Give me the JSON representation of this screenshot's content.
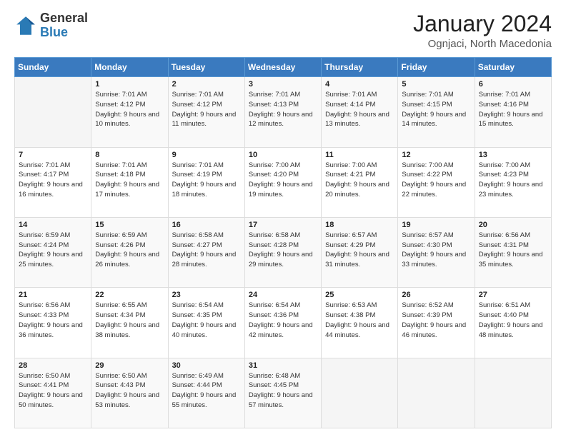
{
  "header": {
    "logo_line1": "General",
    "logo_line2": "Blue",
    "title": "January 2024",
    "subtitle": "Ognjaci, North Macedonia"
  },
  "calendar": {
    "weekdays": [
      "Sunday",
      "Monday",
      "Tuesday",
      "Wednesday",
      "Thursday",
      "Friday",
      "Saturday"
    ],
    "weeks": [
      [
        {
          "day": "",
          "sunrise": "",
          "sunset": "",
          "daylight": "",
          "empty": true
        },
        {
          "day": "1",
          "sunrise": "Sunrise: 7:01 AM",
          "sunset": "Sunset: 4:12 PM",
          "daylight": "Daylight: 9 hours and 10 minutes."
        },
        {
          "day": "2",
          "sunrise": "Sunrise: 7:01 AM",
          "sunset": "Sunset: 4:12 PM",
          "daylight": "Daylight: 9 hours and 11 minutes."
        },
        {
          "day": "3",
          "sunrise": "Sunrise: 7:01 AM",
          "sunset": "Sunset: 4:13 PM",
          "daylight": "Daylight: 9 hours and 12 minutes."
        },
        {
          "day": "4",
          "sunrise": "Sunrise: 7:01 AM",
          "sunset": "Sunset: 4:14 PM",
          "daylight": "Daylight: 9 hours and 13 minutes."
        },
        {
          "day": "5",
          "sunrise": "Sunrise: 7:01 AM",
          "sunset": "Sunset: 4:15 PM",
          "daylight": "Daylight: 9 hours and 14 minutes."
        },
        {
          "day": "6",
          "sunrise": "Sunrise: 7:01 AM",
          "sunset": "Sunset: 4:16 PM",
          "daylight": "Daylight: 9 hours and 15 minutes."
        }
      ],
      [
        {
          "day": "7",
          "sunrise": "Sunrise: 7:01 AM",
          "sunset": "Sunset: 4:17 PM",
          "daylight": "Daylight: 9 hours and 16 minutes."
        },
        {
          "day": "8",
          "sunrise": "Sunrise: 7:01 AM",
          "sunset": "Sunset: 4:18 PM",
          "daylight": "Daylight: 9 hours and 17 minutes."
        },
        {
          "day": "9",
          "sunrise": "Sunrise: 7:01 AM",
          "sunset": "Sunset: 4:19 PM",
          "daylight": "Daylight: 9 hours and 18 minutes."
        },
        {
          "day": "10",
          "sunrise": "Sunrise: 7:00 AM",
          "sunset": "Sunset: 4:20 PM",
          "daylight": "Daylight: 9 hours and 19 minutes."
        },
        {
          "day": "11",
          "sunrise": "Sunrise: 7:00 AM",
          "sunset": "Sunset: 4:21 PM",
          "daylight": "Daylight: 9 hours and 20 minutes."
        },
        {
          "day": "12",
          "sunrise": "Sunrise: 7:00 AM",
          "sunset": "Sunset: 4:22 PM",
          "daylight": "Daylight: 9 hours and 22 minutes."
        },
        {
          "day": "13",
          "sunrise": "Sunrise: 7:00 AM",
          "sunset": "Sunset: 4:23 PM",
          "daylight": "Daylight: 9 hours and 23 minutes."
        }
      ],
      [
        {
          "day": "14",
          "sunrise": "Sunrise: 6:59 AM",
          "sunset": "Sunset: 4:24 PM",
          "daylight": "Daylight: 9 hours and 25 minutes."
        },
        {
          "day": "15",
          "sunrise": "Sunrise: 6:59 AM",
          "sunset": "Sunset: 4:26 PM",
          "daylight": "Daylight: 9 hours and 26 minutes."
        },
        {
          "day": "16",
          "sunrise": "Sunrise: 6:58 AM",
          "sunset": "Sunset: 4:27 PM",
          "daylight": "Daylight: 9 hours and 28 minutes."
        },
        {
          "day": "17",
          "sunrise": "Sunrise: 6:58 AM",
          "sunset": "Sunset: 4:28 PM",
          "daylight": "Daylight: 9 hours and 29 minutes."
        },
        {
          "day": "18",
          "sunrise": "Sunrise: 6:57 AM",
          "sunset": "Sunset: 4:29 PM",
          "daylight": "Daylight: 9 hours and 31 minutes."
        },
        {
          "day": "19",
          "sunrise": "Sunrise: 6:57 AM",
          "sunset": "Sunset: 4:30 PM",
          "daylight": "Daylight: 9 hours and 33 minutes."
        },
        {
          "day": "20",
          "sunrise": "Sunrise: 6:56 AM",
          "sunset": "Sunset: 4:31 PM",
          "daylight": "Daylight: 9 hours and 35 minutes."
        }
      ],
      [
        {
          "day": "21",
          "sunrise": "Sunrise: 6:56 AM",
          "sunset": "Sunset: 4:33 PM",
          "daylight": "Daylight: 9 hours and 36 minutes."
        },
        {
          "day": "22",
          "sunrise": "Sunrise: 6:55 AM",
          "sunset": "Sunset: 4:34 PM",
          "daylight": "Daylight: 9 hours and 38 minutes."
        },
        {
          "day": "23",
          "sunrise": "Sunrise: 6:54 AM",
          "sunset": "Sunset: 4:35 PM",
          "daylight": "Daylight: 9 hours and 40 minutes."
        },
        {
          "day": "24",
          "sunrise": "Sunrise: 6:54 AM",
          "sunset": "Sunset: 4:36 PM",
          "daylight": "Daylight: 9 hours and 42 minutes."
        },
        {
          "day": "25",
          "sunrise": "Sunrise: 6:53 AM",
          "sunset": "Sunset: 4:38 PM",
          "daylight": "Daylight: 9 hours and 44 minutes."
        },
        {
          "day": "26",
          "sunrise": "Sunrise: 6:52 AM",
          "sunset": "Sunset: 4:39 PM",
          "daylight": "Daylight: 9 hours and 46 minutes."
        },
        {
          "day": "27",
          "sunrise": "Sunrise: 6:51 AM",
          "sunset": "Sunset: 4:40 PM",
          "daylight": "Daylight: 9 hours and 48 minutes."
        }
      ],
      [
        {
          "day": "28",
          "sunrise": "Sunrise: 6:50 AM",
          "sunset": "Sunset: 4:41 PM",
          "daylight": "Daylight: 9 hours and 50 minutes."
        },
        {
          "day": "29",
          "sunrise": "Sunrise: 6:50 AM",
          "sunset": "Sunset: 4:43 PM",
          "daylight": "Daylight: 9 hours and 53 minutes."
        },
        {
          "day": "30",
          "sunrise": "Sunrise: 6:49 AM",
          "sunset": "Sunset: 4:44 PM",
          "daylight": "Daylight: 9 hours and 55 minutes."
        },
        {
          "day": "31",
          "sunrise": "Sunrise: 6:48 AM",
          "sunset": "Sunset: 4:45 PM",
          "daylight": "Daylight: 9 hours and 57 minutes."
        },
        {
          "day": "",
          "sunrise": "",
          "sunset": "",
          "daylight": "",
          "empty": true
        },
        {
          "day": "",
          "sunrise": "",
          "sunset": "",
          "daylight": "",
          "empty": true
        },
        {
          "day": "",
          "sunrise": "",
          "sunset": "",
          "daylight": "",
          "empty": true
        }
      ]
    ]
  }
}
